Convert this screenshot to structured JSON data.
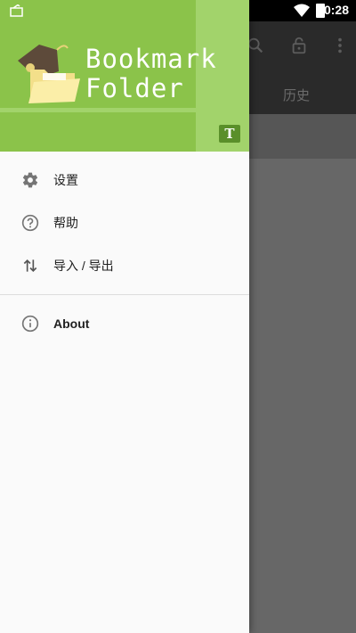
{
  "status_bar": {
    "time": "10:28"
  },
  "background_app": {
    "tab_history": "历史"
  },
  "drawer": {
    "header_title_line1": "Bookmark",
    "header_title_line2": "Folder",
    "header_badge": "T"
  },
  "menu": {
    "settings": "设置",
    "help": "帮助",
    "import_export": "导入 / 导出",
    "about": "About"
  },
  "colors": {
    "header_green": "#8bc34a",
    "header_light_green": "#a2d36b",
    "drawer_bg": "#fafafa",
    "scrim": "#656565"
  }
}
